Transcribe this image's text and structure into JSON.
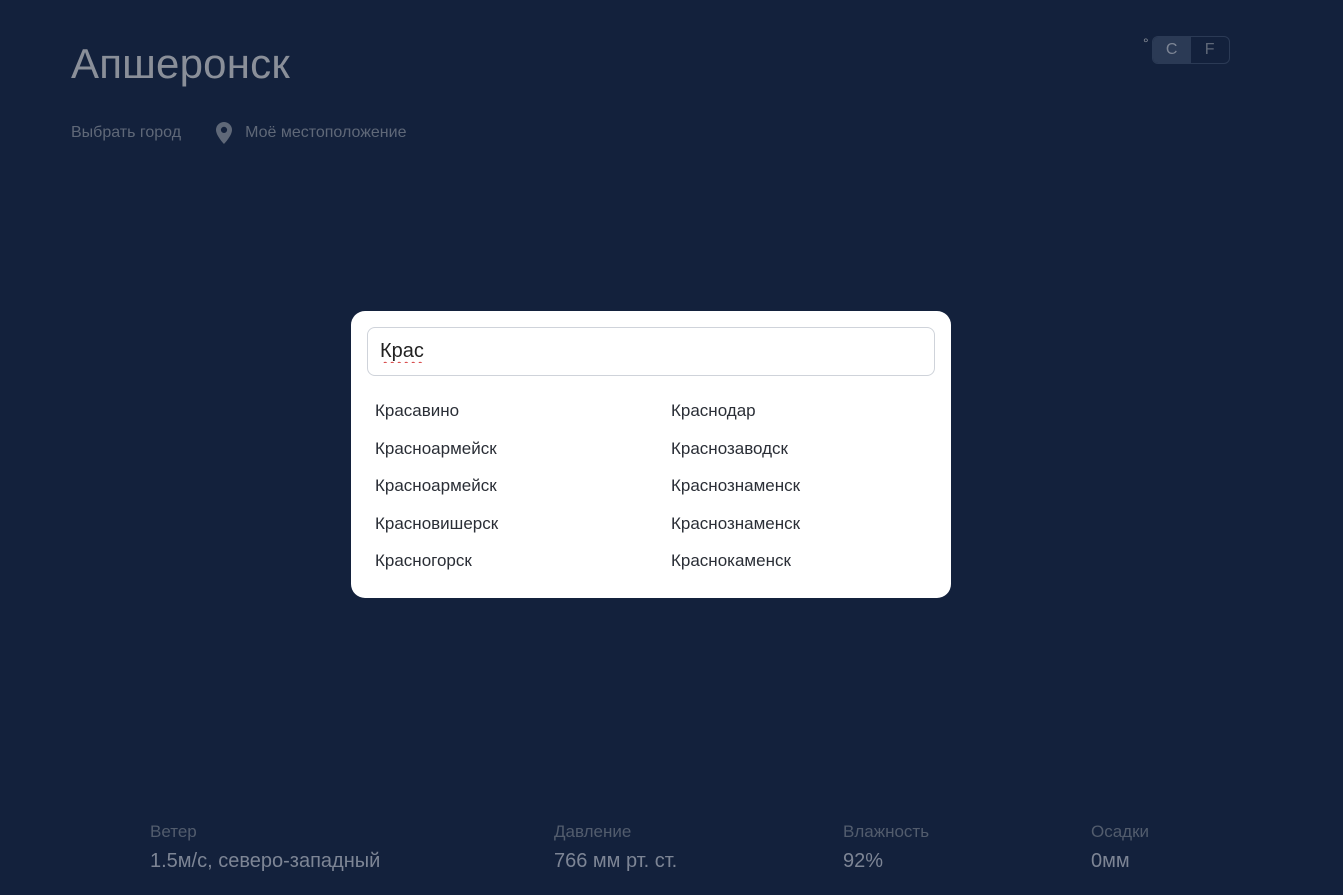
{
  "header": {
    "city": "Апшеронск",
    "choose_city": "Выбрать город",
    "my_location": "Моё местоположение"
  },
  "units": {
    "degree": "°",
    "celsius": "C",
    "fahrenheit": "F",
    "active": "C"
  },
  "stats": {
    "wind": {
      "label": "Ветер",
      "value": "1.5м/с, северо-западный"
    },
    "pressure": {
      "label": "Давление",
      "value": "766 мм рт. ст."
    },
    "humidity": {
      "label": "Влажность",
      "value": "92%"
    },
    "precipitation": {
      "label": "Осадки",
      "value": "0мм"
    }
  },
  "search": {
    "value": "Крас",
    "results_left": [
      "Красавино",
      "Красноармейск",
      "Красноармейск",
      "Красновишерск",
      "Красногорск"
    ],
    "results_right": [
      "Краснодар",
      "Краснозаводск",
      "Краснознаменск",
      "Краснознаменск",
      "Краснокаменск"
    ]
  },
  "icons": {
    "location": "map-pin-icon"
  },
  "colors": {
    "background": "#13213c",
    "modal": "#ffffff",
    "muted_text": "#7d8595"
  }
}
